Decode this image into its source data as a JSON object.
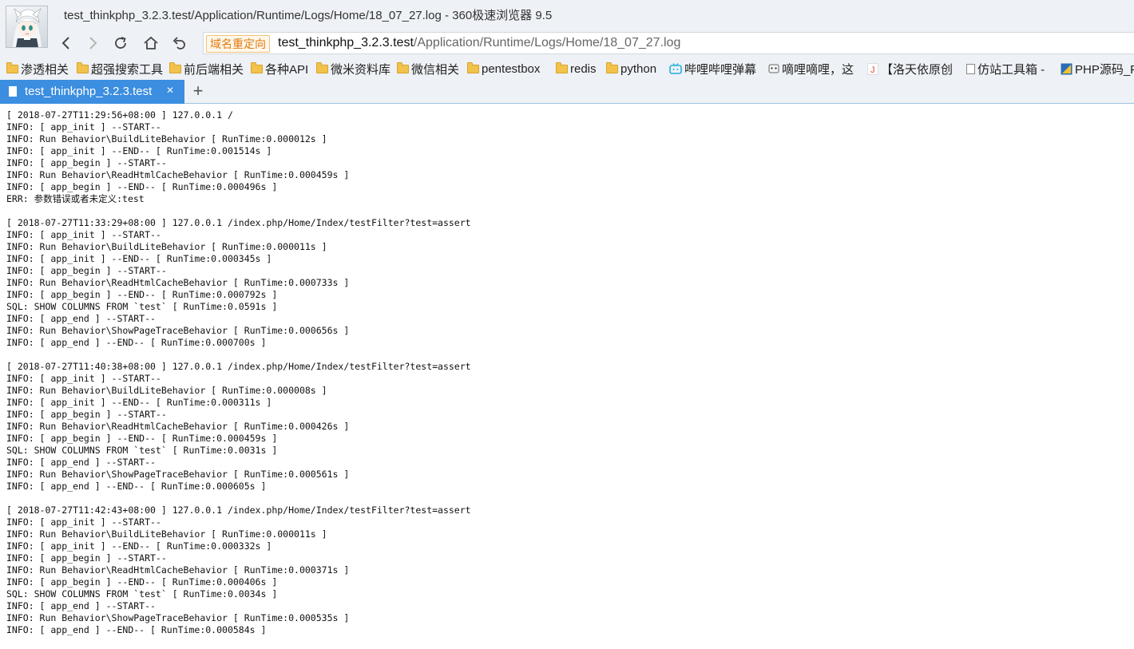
{
  "window": {
    "title": "test_thinkphp_3.2.3.test/Application/Runtime/Logs/Home/18_07_27.log - 360极速浏览器 9.5"
  },
  "nav": {
    "icons": [
      "back-arrow-icon",
      "forward-arrow-icon",
      "refresh-icon",
      "home-icon",
      "undo-icon"
    ],
    "redirect_badge": "域名重定向",
    "url_host": "test_thinkphp_3.2.3.test",
    "url_path": "/Application/Runtime/Logs/Home/18_07_27.log"
  },
  "bookmarks": [
    {
      "label": "渗透相关",
      "icon": "folder-icon"
    },
    {
      "label": "超强搜索工具",
      "icon": "folder-icon"
    },
    {
      "label": "前后端相关",
      "icon": "folder-icon"
    },
    {
      "label": "各种API",
      "icon": "folder-icon"
    },
    {
      "label": "微米资料库",
      "icon": "folder-icon"
    },
    {
      "label": "微信相关",
      "icon": "folder-icon"
    },
    {
      "label": "pentestbox",
      "icon": "folder-icon"
    },
    {
      "label": "redis",
      "icon": "folder-icon"
    },
    {
      "label": "python",
      "icon": "folder-icon"
    },
    {
      "label": "哔哩哔哩弹幕",
      "icon": "bilibili-icon"
    },
    {
      "label": "嘀哩嘀哩，这",
      "icon": "face-icon"
    },
    {
      "label": "【洛天依原创",
      "icon": "j-icon"
    },
    {
      "label": "仿站工具箱 -",
      "icon": "page-icon"
    },
    {
      "label": "PHP源码_P",
      "icon": "php-icon"
    }
  ],
  "tabs": {
    "active_label": "test_thinkphp_3.2.3.test",
    "close_glyph": "×",
    "new_tab_glyph": "+"
  },
  "colors": {
    "accent": "#3b8ee0",
    "badge_text": "#e07a10",
    "chrome_bg": "#eef1f5"
  },
  "log_lines": [
    "[ 2018-07-27T11:29:56+08:00 ] 127.0.0.1 /",
    "INFO: [ app_init ] --START--",
    "INFO: Run Behavior\\BuildLiteBehavior [ RunTime:0.000012s ]",
    "INFO: [ app_init ] --END-- [ RunTime:0.001514s ]",
    "INFO: [ app_begin ] --START--",
    "INFO: Run Behavior\\ReadHtmlCacheBehavior [ RunTime:0.000459s ]",
    "INFO: [ app_begin ] --END-- [ RunTime:0.000496s ]",
    "ERR: 参数错误或者未定义:test",
    "",
    "[ 2018-07-27T11:33:29+08:00 ] 127.0.0.1 /index.php/Home/Index/testFilter?test=assert",
    "INFO: [ app_init ] --START--",
    "INFO: Run Behavior\\BuildLiteBehavior [ RunTime:0.000011s ]",
    "INFO: [ app_init ] --END-- [ RunTime:0.000345s ]",
    "INFO: [ app_begin ] --START--",
    "INFO: Run Behavior\\ReadHtmlCacheBehavior [ RunTime:0.000733s ]",
    "INFO: [ app_begin ] --END-- [ RunTime:0.000792s ]",
    "SQL: SHOW COLUMNS FROM `test` [ RunTime:0.0591s ]",
    "INFO: [ app_end ] --START--",
    "INFO: Run Behavior\\ShowPageTraceBehavior [ RunTime:0.000656s ]",
    "INFO: [ app_end ] --END-- [ RunTime:0.000700s ]",
    "",
    "[ 2018-07-27T11:40:38+08:00 ] 127.0.0.1 /index.php/Home/Index/testFilter?test=assert",
    "INFO: [ app_init ] --START--",
    "INFO: Run Behavior\\BuildLiteBehavior [ RunTime:0.000008s ]",
    "INFO: [ app_init ] --END-- [ RunTime:0.000311s ]",
    "INFO: [ app_begin ] --START--",
    "INFO: Run Behavior\\ReadHtmlCacheBehavior [ RunTime:0.000426s ]",
    "INFO: [ app_begin ] --END-- [ RunTime:0.000459s ]",
    "SQL: SHOW COLUMNS FROM `test` [ RunTime:0.0031s ]",
    "INFO: [ app_end ] --START--",
    "INFO: Run Behavior\\ShowPageTraceBehavior [ RunTime:0.000561s ]",
    "INFO: [ app_end ] --END-- [ RunTime:0.000605s ]",
    "",
    "[ 2018-07-27T11:42:43+08:00 ] 127.0.0.1 /index.php/Home/Index/testFilter?test=assert",
    "INFO: [ app_init ] --START--",
    "INFO: Run Behavior\\BuildLiteBehavior [ RunTime:0.000011s ]",
    "INFO: [ app_init ] --END-- [ RunTime:0.000332s ]",
    "INFO: [ app_begin ] --START--",
    "INFO: Run Behavior\\ReadHtmlCacheBehavior [ RunTime:0.000371s ]",
    "INFO: [ app_begin ] --END-- [ RunTime:0.000406s ]",
    "SQL: SHOW COLUMNS FROM `test` [ RunTime:0.0034s ]",
    "INFO: [ app_end ] --START--",
    "INFO: Run Behavior\\ShowPageTraceBehavior [ RunTime:0.000535s ]",
    "INFO: [ app_end ] --END-- [ RunTime:0.000584s ]"
  ]
}
